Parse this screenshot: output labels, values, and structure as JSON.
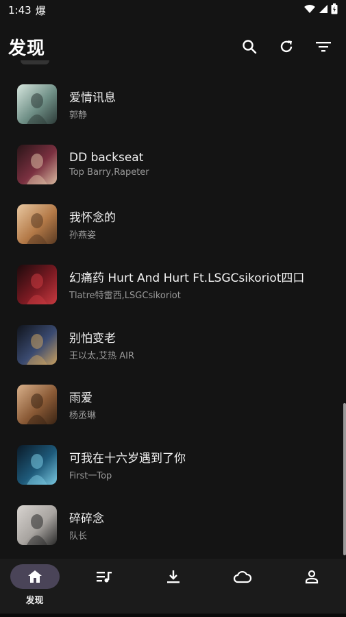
{
  "status_bar": {
    "time": "1:43",
    "notification_glyph": "爆",
    "icons": [
      "wifi-icon",
      "cellular-icon",
      "battery-icon"
    ]
  },
  "app_bar": {
    "title": "发现",
    "actions": [
      "search-icon",
      "refresh-icon",
      "filter-icon"
    ]
  },
  "songs": [
    {
      "title": "爱情讯息",
      "artist": "郭静",
      "art_colors": [
        "#d6e6de",
        "#6f8f86",
        "#2d3b38"
      ]
    },
    {
      "title": "DD backseat",
      "artist": "Top Barry,Rapeter",
      "art_colors": [
        "#2a1518",
        "#7a3040",
        "#d9b9a0"
      ]
    },
    {
      "title": "我怀念的",
      "artist": "孙燕姿",
      "art_colors": [
        "#e8c7a0",
        "#b47a48",
        "#5a3a22"
      ]
    },
    {
      "title": "幻痛药 Hurt And Hurt Ft.LSGCsikoriot四口",
      "artist": "Tlatre特雷西,LSGCsikoriot",
      "art_colors": [
        "#1c0a0c",
        "#7a1a22",
        "#c83a40"
      ]
    },
    {
      "title": "别怕变老",
      "artist": "王以太,艾热 AIR",
      "art_colors": [
        "#10141c",
        "#3a4a70",
        "#c8a060"
      ]
    },
    {
      "title": "雨爱",
      "artist": "杨丞琳",
      "art_colors": [
        "#d8b08a",
        "#8a5a36",
        "#3a2414"
      ]
    },
    {
      "title": "可我在十六岁遇到了你",
      "artist": "First一Top",
      "art_colors": [
        "#0a1a28",
        "#1e5a7a",
        "#7ac8e0"
      ]
    },
    {
      "title": "碎碎念",
      "artist": "队长",
      "art_colors": [
        "#d8d4d0",
        "#a8a4a0",
        "#2a2a2a"
      ]
    }
  ],
  "bottom_nav": {
    "items": [
      {
        "icon": "home-icon",
        "label": "发现",
        "active": true
      },
      {
        "icon": "playlist-icon",
        "label": "",
        "active": false
      },
      {
        "icon": "download-icon",
        "label": "",
        "active": false
      },
      {
        "icon": "cloud-icon",
        "label": "",
        "active": false
      },
      {
        "icon": "profile-icon",
        "label": "",
        "active": false
      }
    ]
  },
  "colors": {
    "background": "#141414",
    "nav_background": "#1b1b1b",
    "active_pill": "#4a4458",
    "secondary_text": "#9a9a9a"
  }
}
